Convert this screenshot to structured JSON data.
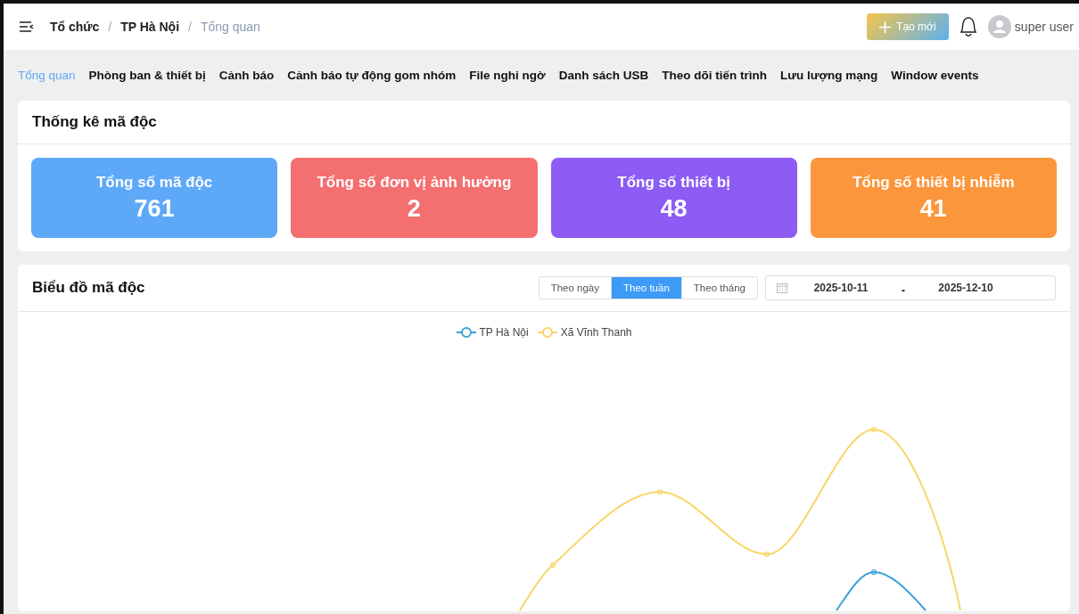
{
  "breadcrumb": [
    {
      "label": "Tổ chức",
      "current": false
    },
    {
      "label": "TP Hà Nội",
      "current": false
    },
    {
      "label": "Tổng quan",
      "current": true
    }
  ],
  "breadcrumb_separator": "/",
  "header": {
    "create_button": "Tạo mới",
    "user": "super user"
  },
  "tabs": [
    {
      "label": "Tổng quan",
      "selected": true
    },
    {
      "label": "Phòng ban & thiết bị",
      "selected": false
    },
    {
      "label": "Cảnh báo",
      "selected": false
    },
    {
      "label": "Cảnh báo tự động gom nhóm",
      "selected": false
    },
    {
      "label": "File nghi ngờ",
      "selected": false
    },
    {
      "label": "Danh sách USB",
      "selected": false
    },
    {
      "label": "Theo dõi tiến trình",
      "selected": false
    },
    {
      "label": "Lưu lượng mạng",
      "selected": false
    },
    {
      "label": "Window events",
      "selected": false
    }
  ],
  "stats": {
    "title": "Thống kê mã độc",
    "cards": [
      {
        "label": "Tổng số mã độc",
        "value": "761",
        "color": "#5ea8f8"
      },
      {
        "label": "Tổng số đơn vị ảnh hưởng",
        "value": "2",
        "color": "#f46f6f"
      },
      {
        "label": "Tổng số thiết bị",
        "value": "48",
        "color": "#8c5cf4"
      },
      {
        "label": "Tổng số thiết bị nhiễm",
        "value": "41",
        "color": "#fb963c"
      }
    ]
  },
  "chart": {
    "title": "Biểu đồ mã độc",
    "periods": [
      {
        "label": "Theo ngày",
        "selected": false
      },
      {
        "label": "Theo tuần",
        "selected": true
      },
      {
        "label": "Theo tháng",
        "selected": false
      }
    ],
    "date_from": "2025-10-11",
    "date_to": "2025-12-10",
    "separator": "-",
    "legend": [
      {
        "name": "TP Hà Nội",
        "color": "#3ba2d9"
      },
      {
        "name": "Xã Vĩnh Thanh",
        "color": "#f9d565"
      }
    ]
  }
}
